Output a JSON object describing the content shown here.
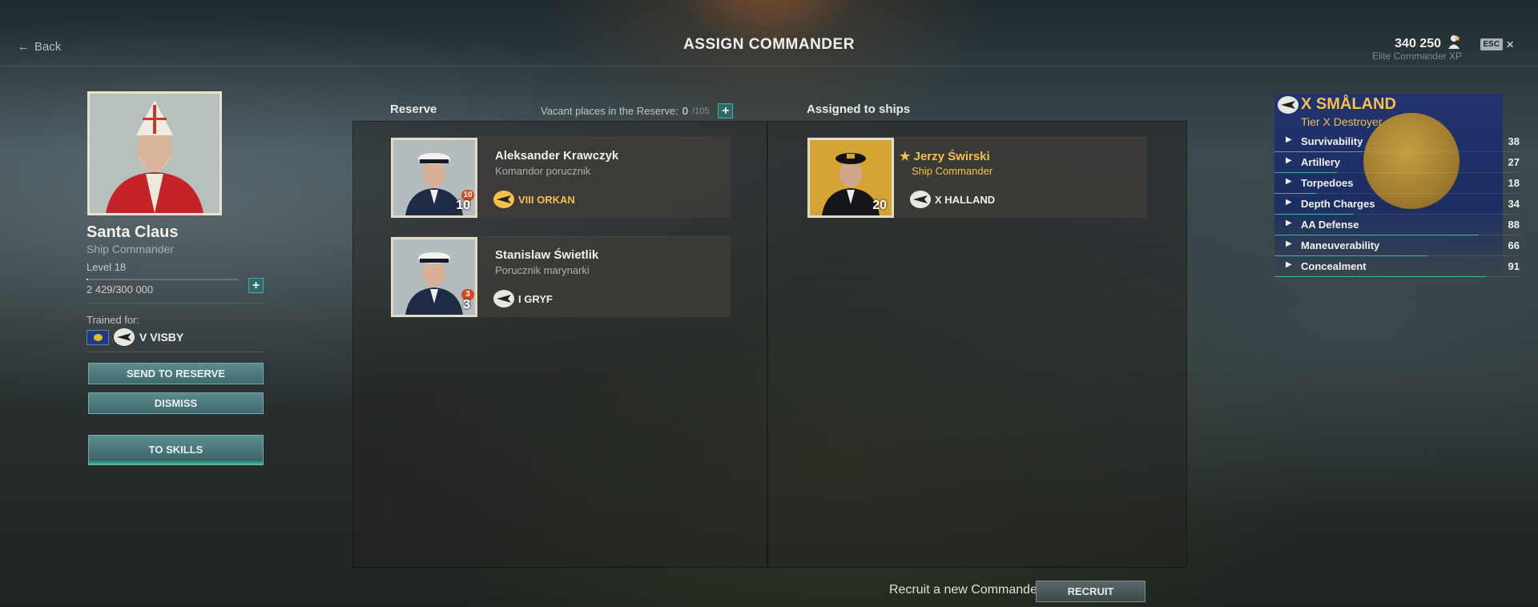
{
  "header": {
    "back_label": "Back",
    "title": "ASSIGN COMMANDER",
    "xp_value": "340 250",
    "xp_label": "Elite Commander XP",
    "esc_label": "ESC"
  },
  "commander": {
    "name": "Santa Claus",
    "rank": "Ship Commander",
    "level": "Level 18",
    "xp_progress_fraction": 0.0081,
    "xp_text": "2 429/300 000",
    "trained_for_label": "Trained for:",
    "trained_ship": "V VISBY",
    "buttons": {
      "send_to_reserve": "SEND TO RESERVE",
      "dismiss": "DISMISS",
      "to_skills": "TO SKILLS"
    }
  },
  "reserve": {
    "header": "Reserve",
    "vacant_label": "Vacant places in the Reserve:",
    "vacant_count": "0",
    "vacant_total": "/105",
    "cards": [
      {
        "name": "Aleksander Krawczyk",
        "rank": "Komandor porucznik",
        "level": "10",
        "badge": "10",
        "ship": "VIII ORKAN",
        "ship_highlight": true
      },
      {
        "name": "Stanislaw Świetlik",
        "rank": "Porucznik marynarki",
        "level": "3",
        "badge": "3",
        "ship": "I GRYF",
        "ship_highlight": false
      }
    ]
  },
  "assigned": {
    "header": "Assigned to ships",
    "cards": [
      {
        "name": "Jerzy Świrski",
        "rank": "Ship Commander",
        "level": "20",
        "ship": "X HALLAND"
      }
    ]
  },
  "ship": {
    "name": "X SMÅLAND",
    "tier": "Tier X Destroyer",
    "stats": [
      {
        "label": "Survivability",
        "value": "38"
      },
      {
        "label": "Artillery",
        "value": "27"
      },
      {
        "label": "Torpedoes",
        "value": "18"
      },
      {
        "label": "Depth Charges",
        "value": "34"
      },
      {
        "label": "AA Defense",
        "value": "88"
      },
      {
        "label": "Maneuverability",
        "value": "66"
      },
      {
        "label": "Concealment",
        "value": "91"
      }
    ]
  },
  "footer": {
    "recruit_text": "Recruit a new Commander",
    "recruit_button": "RECRUIT"
  },
  "colors": {
    "accent_gold": "#f3c04c",
    "teal_button": "#3f6a6e",
    "badge_orange": "#d44a22"
  }
}
